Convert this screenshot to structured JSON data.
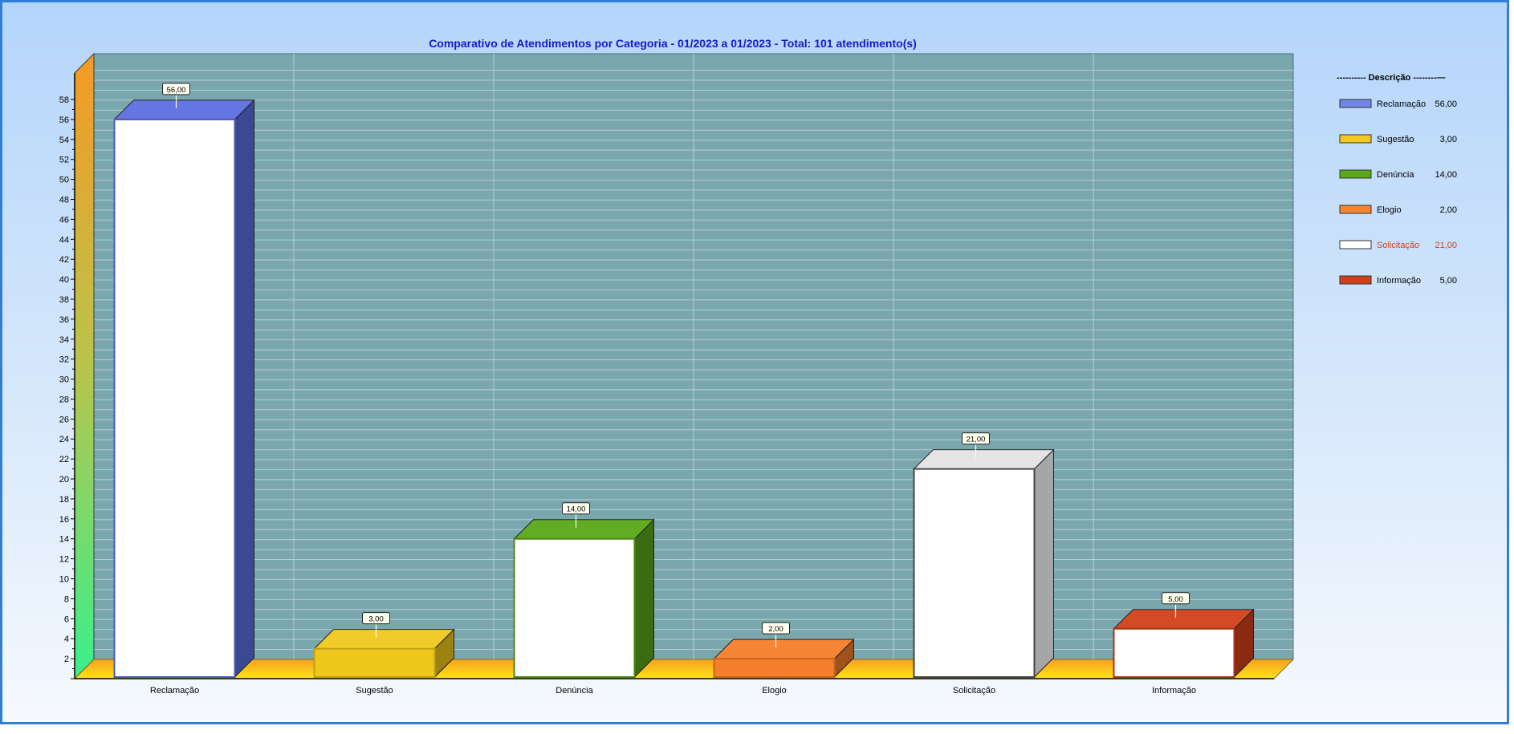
{
  "chart_data": {
    "type": "bar",
    "title": "Comparativo de Atendimentos por Categoria - 01/2023 a 01/2023 - Total: 101 atendimento(s)",
    "categories": [
      "Reclamação",
      "Sugestão",
      "Denúncia",
      "Elogio",
      "Solicitação",
      "Informação"
    ],
    "values": [
      56,
      3,
      14,
      2,
      21,
      5
    ],
    "value_labels": [
      "56,00",
      "3,00",
      "14,00",
      "2,00",
      "21,00",
      "5,00"
    ],
    "colors": [
      "#5b6fe0",
      "#f0c81c",
      "#5aa818",
      "#f57f2a",
      "#ffffff",
      "#d2401a"
    ],
    "y_ticks": [
      2,
      4,
      6,
      8,
      10,
      12,
      14,
      16,
      18,
      20,
      22,
      24,
      26,
      28,
      30,
      32,
      34,
      36,
      38,
      40,
      42,
      44,
      46,
      48,
      50,
      52,
      54,
      56,
      58
    ],
    "ylim": [
      0,
      58
    ],
    "grid": true,
    "legend": {
      "title": "---------- Descrição --------—",
      "placement": "right",
      "items": [
        {
          "name": "Reclamação",
          "value": "56,00",
          "color": "#6f86e6",
          "text_color": "#000000"
        },
        {
          "name": "Sugestão",
          "value": "3,00",
          "color": "#f2c81c",
          "text_color": "#000000"
        },
        {
          "name": "Denúncia",
          "value": "14,00",
          "color": "#5aa818",
          "text_color": "#000000"
        },
        {
          "name": "Elogio",
          "value": "2,00",
          "color": "#f5842e",
          "text_color": "#000000"
        },
        {
          "name": "Solicitação",
          "value": "21,00",
          "color": "#ffffff",
          "text_color": "#d2401a"
        },
        {
          "name": "Informação",
          "value": "5,00",
          "color": "#d2401a",
          "text_color": "#000000"
        }
      ]
    },
    "plot_background": "#7aa7ae",
    "floor_color": "#ffd21e",
    "wall_colors": [
      "#38f08c",
      "#f59a24"
    ]
  }
}
